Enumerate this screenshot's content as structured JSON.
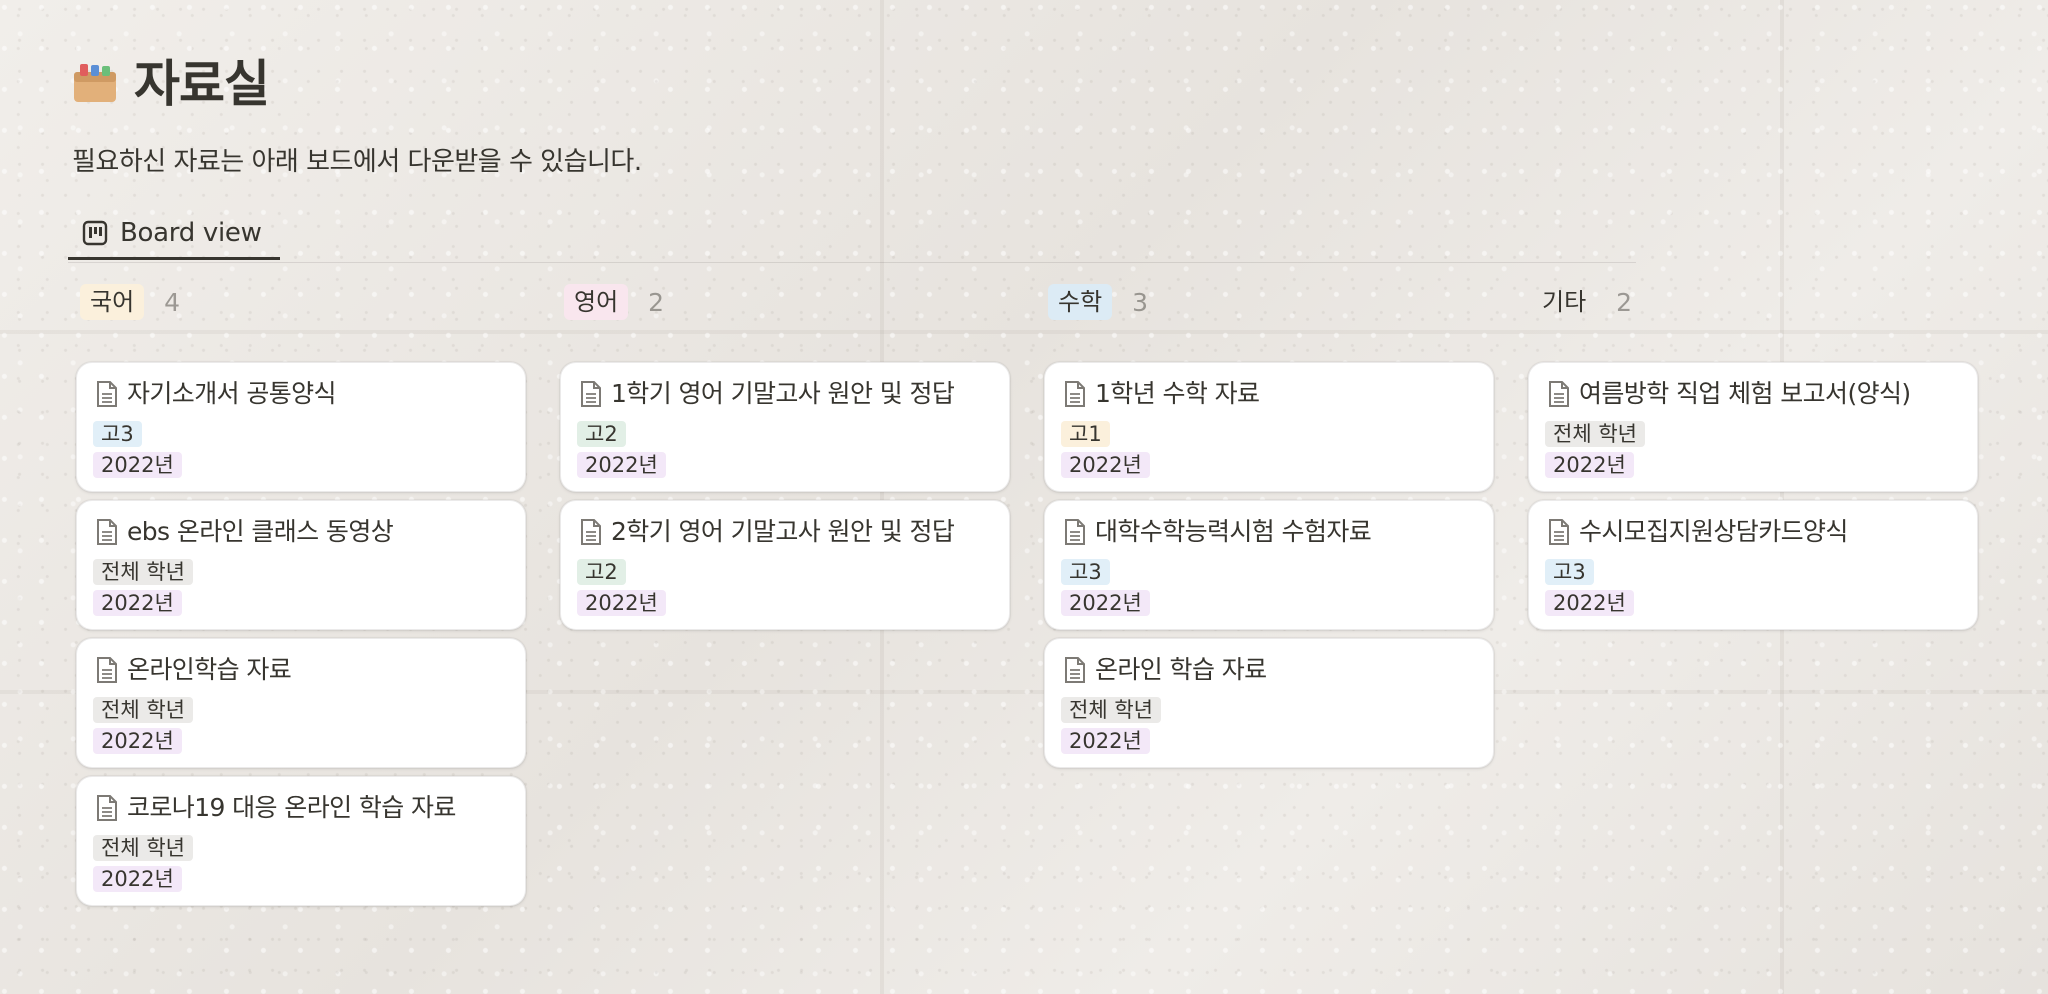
{
  "page": {
    "icon": "card-file-box-icon",
    "title": "자료실",
    "description": "필요하신 자료는 아래 보드에서 다운받을 수 있습니다."
  },
  "view": {
    "icon": "board-icon",
    "tab_label": "Board view"
  },
  "colors": {
    "text": "#37352f",
    "card_background": "#ffffff",
    "year_tag": "#f3e8f8"
  },
  "board": {
    "columns": [
      {
        "label": "국어",
        "count": "4",
        "tag_color": "#fbf0dc",
        "cards": [
          {
            "title": "자기소개서 공통양식",
            "grade": "고3",
            "grade_color": "#e1eff8",
            "year": "2022년"
          },
          {
            "title": "ebs 온라인 클래스 동영상",
            "grade": "전체 학년",
            "grade_color": "#ebeae8",
            "year": "2022년"
          },
          {
            "title": "온라인학습 자료",
            "grade": "전체 학년",
            "grade_color": "#ebeae8",
            "year": "2022년"
          },
          {
            "title": "코로나19 대응 온라인 학습 자료",
            "grade": "전체 학년",
            "grade_color": "#ebeae8",
            "year": "2022년"
          }
        ]
      },
      {
        "label": "영어",
        "count": "2",
        "tag_color": "#f9e6ee",
        "cards": [
          {
            "title": "1학기 영어 기말고사 원안 및 정답",
            "grade": "고2",
            "grade_color": "#e2efe6",
            "year": "2022년"
          },
          {
            "title": "2학기 영어 기말고사 원안 및 정답",
            "grade": "고2",
            "grade_color": "#e2efe6",
            "year": "2022년"
          }
        ]
      },
      {
        "label": "수학",
        "count": "3",
        "tag_color": "#dcebf5",
        "cards": [
          {
            "title": "1학년 수학 자료",
            "grade": "고1",
            "grade_color": "#fbf0dc",
            "year": "2022년"
          },
          {
            "title": "대학수학능력시험 수험자료",
            "grade": "고3",
            "grade_color": "#e1eff8",
            "year": "2022년"
          },
          {
            "title": "온라인 학습 자료",
            "grade": "전체 학년",
            "grade_color": "#ebeae8",
            "year": "2022년"
          }
        ]
      },
      {
        "label": "기타",
        "count": "2",
        "tag_color": "rgba(0,0,0,0)",
        "cards": [
          {
            "title": "여름방학 직업 체험 보고서(양식)",
            "grade": "전체 학년",
            "grade_color": "#ebeae8",
            "year": "2022년"
          },
          {
            "title": "수시모집지원상담카드양식",
            "grade": "고3",
            "grade_color": "#e1eff8",
            "year": "2022년"
          }
        ]
      }
    ]
  }
}
